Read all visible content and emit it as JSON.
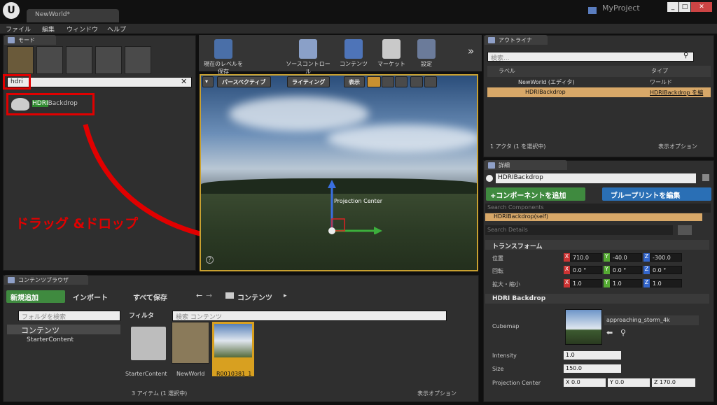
{
  "window": {
    "doc_tab": "NewWorld*",
    "project": "MyProject",
    "min": "_",
    "max": "□",
    "close": "✕"
  },
  "menu": [
    "ファイル",
    "編集",
    "ウィンドウ",
    "ヘルプ"
  ],
  "modes": {
    "tab": "モード",
    "search_value": "hdri",
    "result": {
      "highlight": "HDRI",
      "rest": "Backdrop"
    }
  },
  "annotation": {
    "text": "ドラッグ &ドロップ",
    "color": "#e10000"
  },
  "toolbar": {
    "items": [
      "現在のレベルを保存",
      "ソースコントロール",
      "コンテンツ",
      "マーケット",
      "設定"
    ],
    "more": "»"
  },
  "viewport": {
    "perspective": "パースペクティブ",
    "lighting": "ライティング",
    "show": "表示",
    "gizmo_label": "Projection Center",
    "help": "?"
  },
  "outliner": {
    "tab": "アウトライナ",
    "search_placeholder": "検索...",
    "col_label": "ラベル",
    "col_type": "タイプ",
    "rows": [
      {
        "label": "NewWorld (エディタ)",
        "type": "ワールド"
      },
      {
        "label": "HDRIBackdrop",
        "type": "HDRIBackdrop を編"
      }
    ],
    "footer": "1 アクタ (1 を選択中)",
    "view_options": "表示オプション"
  },
  "details": {
    "tab": "詳細",
    "name": "HDRIBackdrop",
    "add_component": "+コンポーネントを追加",
    "blueprint": "ブループリントを編集",
    "search_components": "Search Components",
    "self_row": "HDRIBackdrop(self)",
    "search_details": "Search Details",
    "transform_section": "トランスフォーム",
    "location": {
      "label": "位置",
      "x": "710.0",
      "y": "-40.0",
      "z": "-300.0"
    },
    "rotation": {
      "label": "回転",
      "x": "0.0 °",
      "y": "0.0 °",
      "z": "0.0 °"
    },
    "scale": {
      "label": "拡大・縮小",
      "x": "1.0",
      "y": "1.0",
      "z": "1.0"
    },
    "hdri_section": "HDRI Backdrop",
    "cubemap_label": "Cubemap",
    "cubemap_value": "approaching_storm_4k",
    "intensity_label": "Intensity",
    "intensity": "1.0",
    "size_label": "Size",
    "size": "150.0",
    "proj_label": "Projection Center",
    "proj": {
      "x": "0.0",
      "y": "0.0",
      "z": "170.0"
    }
  },
  "content": {
    "tab": "コンテンツブラウザ",
    "add_new": "新規追加",
    "import": "インポート",
    "save_all": "すべて保存",
    "path": "コンテンツ",
    "folder_search": "フォルダを検索",
    "filter": "フィルタ",
    "search_placeholder": "検索 コンテンツ",
    "tree": [
      {
        "label": "コンテンツ"
      },
      {
        "label": "StarterContent"
      }
    ],
    "assets": [
      "StarterContent",
      "NewWorld",
      "R0010381_1"
    ],
    "footer": "3 アイテム (1 選択中)",
    "view_options": "表示オプション"
  }
}
